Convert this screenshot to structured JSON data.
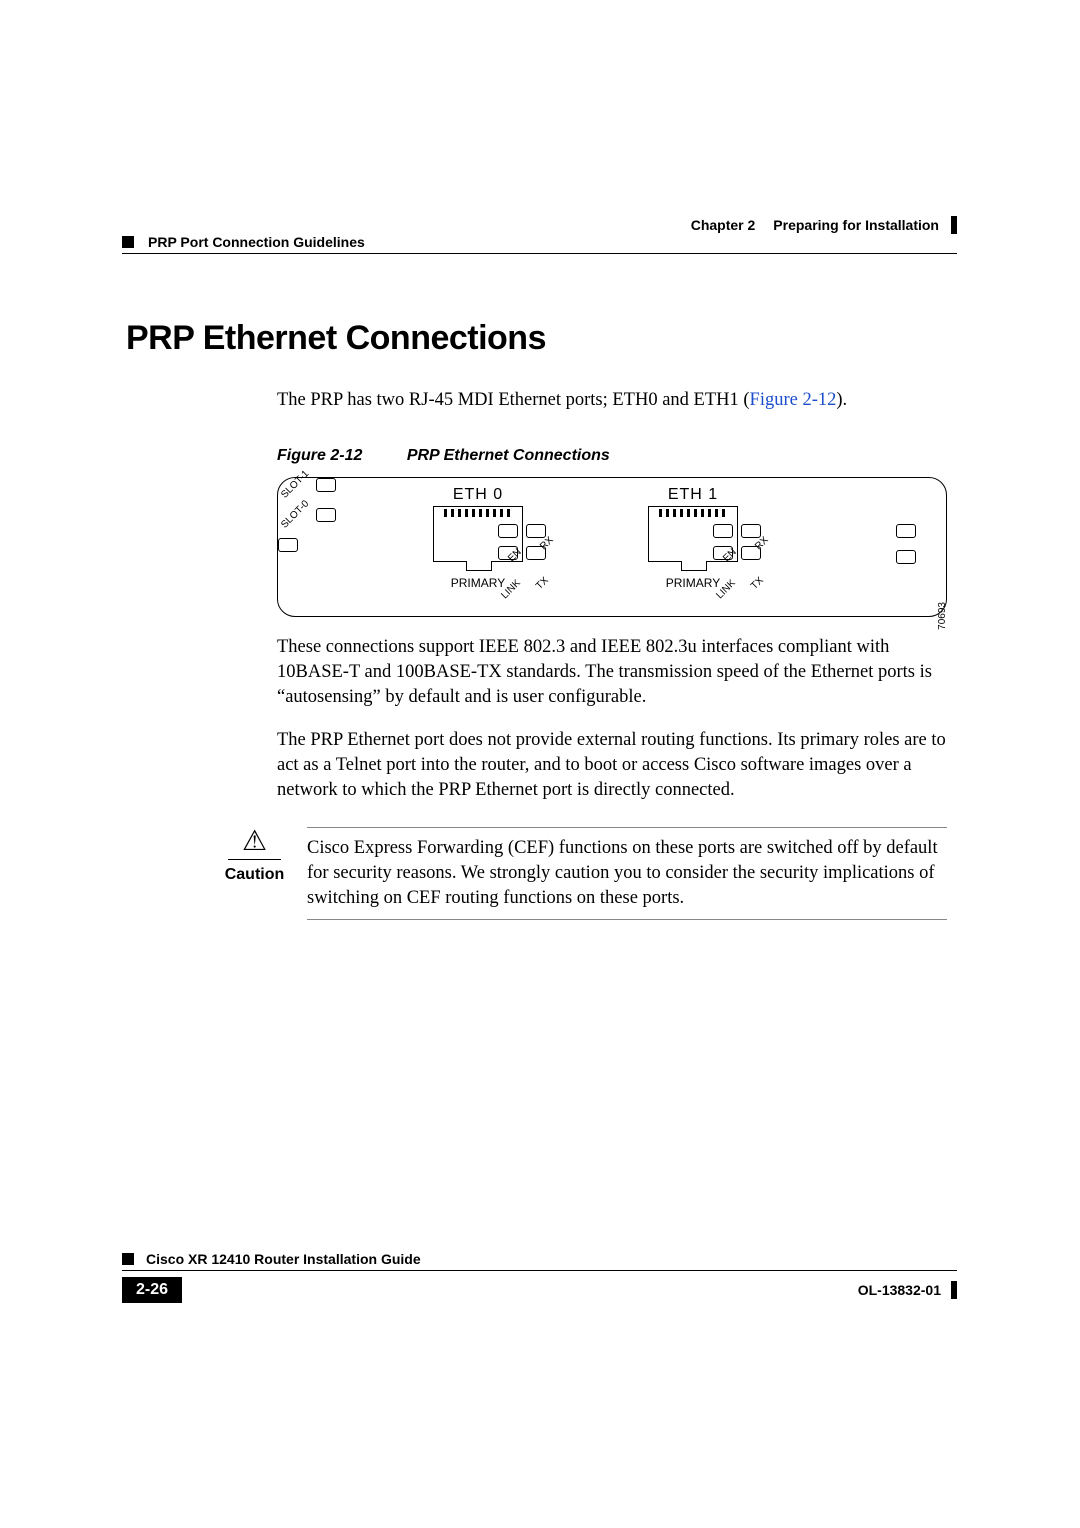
{
  "header": {
    "section_left": "PRP Port Connection Guidelines",
    "chapter_label": "Chapter 2",
    "chapter_title": "Preparing for Installation"
  },
  "title": "PRP Ethernet Connections",
  "intro": {
    "text_before_xref": "The PRP has two RJ-45 MDI Ethernet ports; ETH0 and ETH1 (",
    "xref": "Figure 2-12",
    "text_after_xref": ")."
  },
  "figure": {
    "number": "Figure 2-12",
    "caption": "PRP Ethernet Connections",
    "drawing_id": "70693",
    "slots": [
      "SLOT-1",
      "SLOT-0"
    ],
    "ports": [
      {
        "name": "ETH 0",
        "primary": "PRIMARY",
        "leds": [
          "LINK",
          "EN",
          "TX",
          "RX"
        ]
      },
      {
        "name": "ETH 1",
        "primary": "PRIMARY",
        "leds": [
          "LINK",
          "EN",
          "TX",
          "RX"
        ]
      }
    ]
  },
  "paragraphs": [
    "These connections support IEEE 802.3 and IEEE 802.3u interfaces compliant with 10BASE-T and 100BASE-TX standards. The transmission speed of the Ethernet ports is “autosensing” by default and is user configurable.",
    "The PRP Ethernet port does not provide external routing functions. Its primary roles are to act as a Telnet port into the router, and to boot or access Cisco software images over a network to which the PRP Ethernet port is directly connected."
  ],
  "caution": {
    "label": "Caution",
    "text": "Cisco Express Forwarding (CEF) functions on these ports are switched off by default for security reasons. We strongly caution you to consider the security implications of switching on CEF routing functions on these ports."
  },
  "footer": {
    "guide": "Cisco XR 12410 Router Installation Guide",
    "page": "2-26",
    "doc_id": "OL-13832-01"
  }
}
